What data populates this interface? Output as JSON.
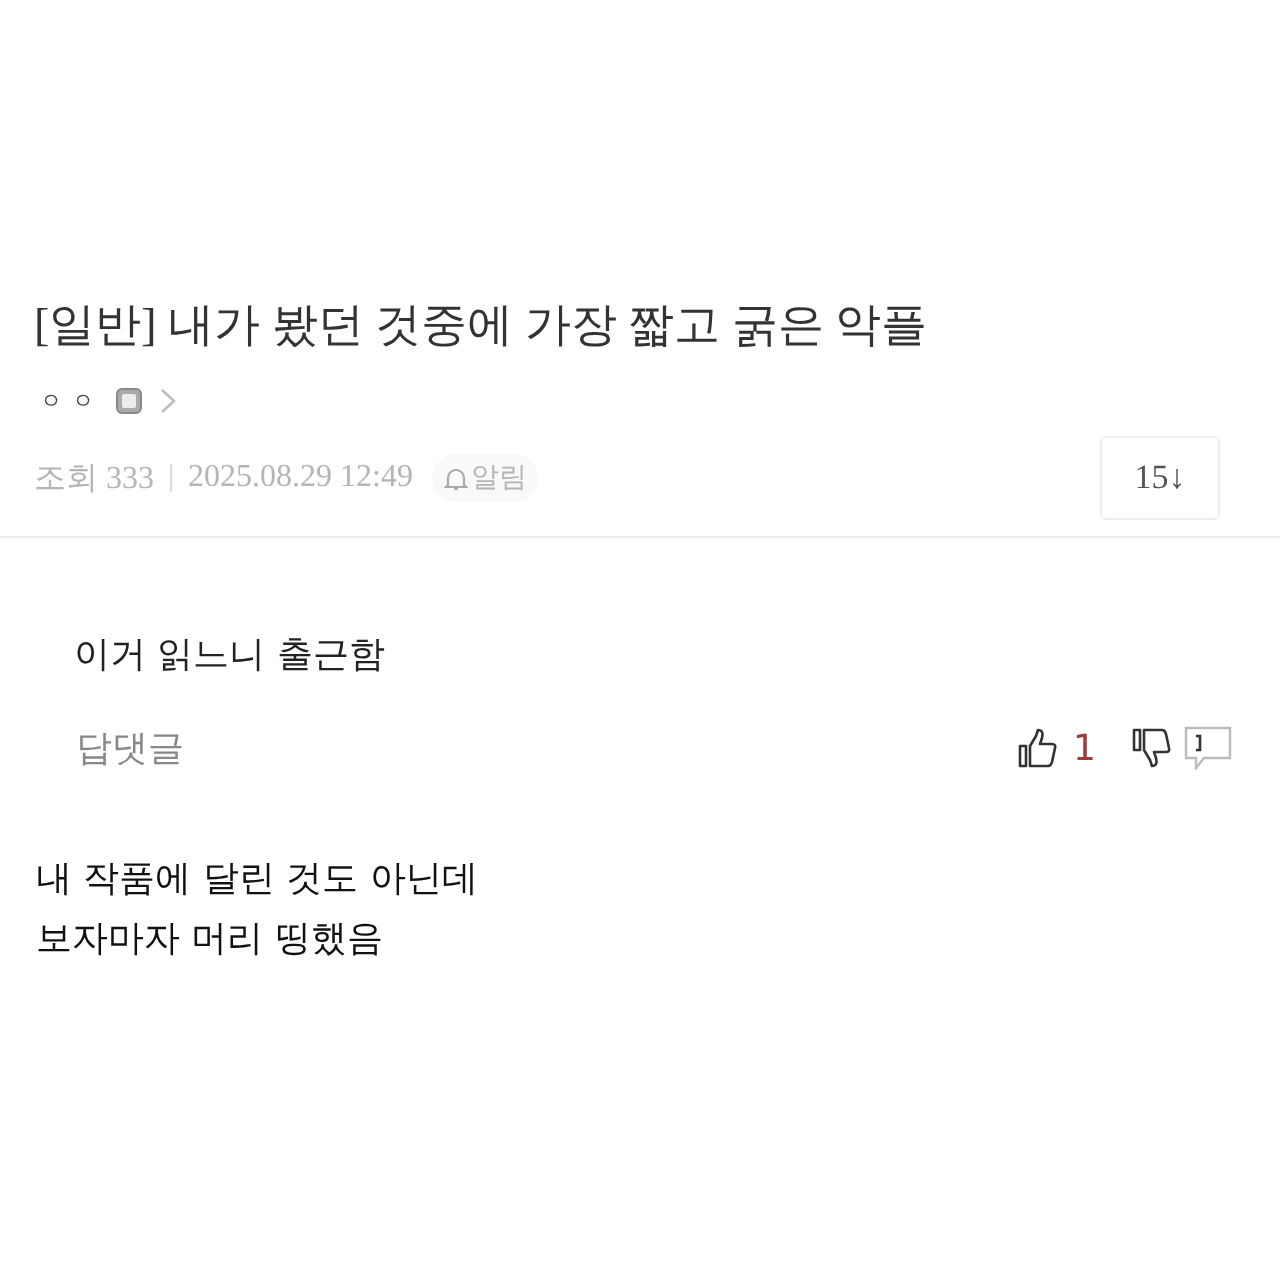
{
  "post": {
    "title": "[일반] 내가 봤던 것중에 가장 짧고 굵은 악플",
    "author": "ㅇㅇ",
    "views": "조회 333",
    "date": "2025.08.29 12:49",
    "alarm": "알림",
    "comment_button": "15↓"
  },
  "comment": {
    "text": "이거 읽느니 출근함",
    "reply": "답댓글",
    "likes": "1"
  },
  "body_lines": [
    "내 작품에 달린 것도 아닌데",
    "보자마자 머리 띵했음"
  ]
}
